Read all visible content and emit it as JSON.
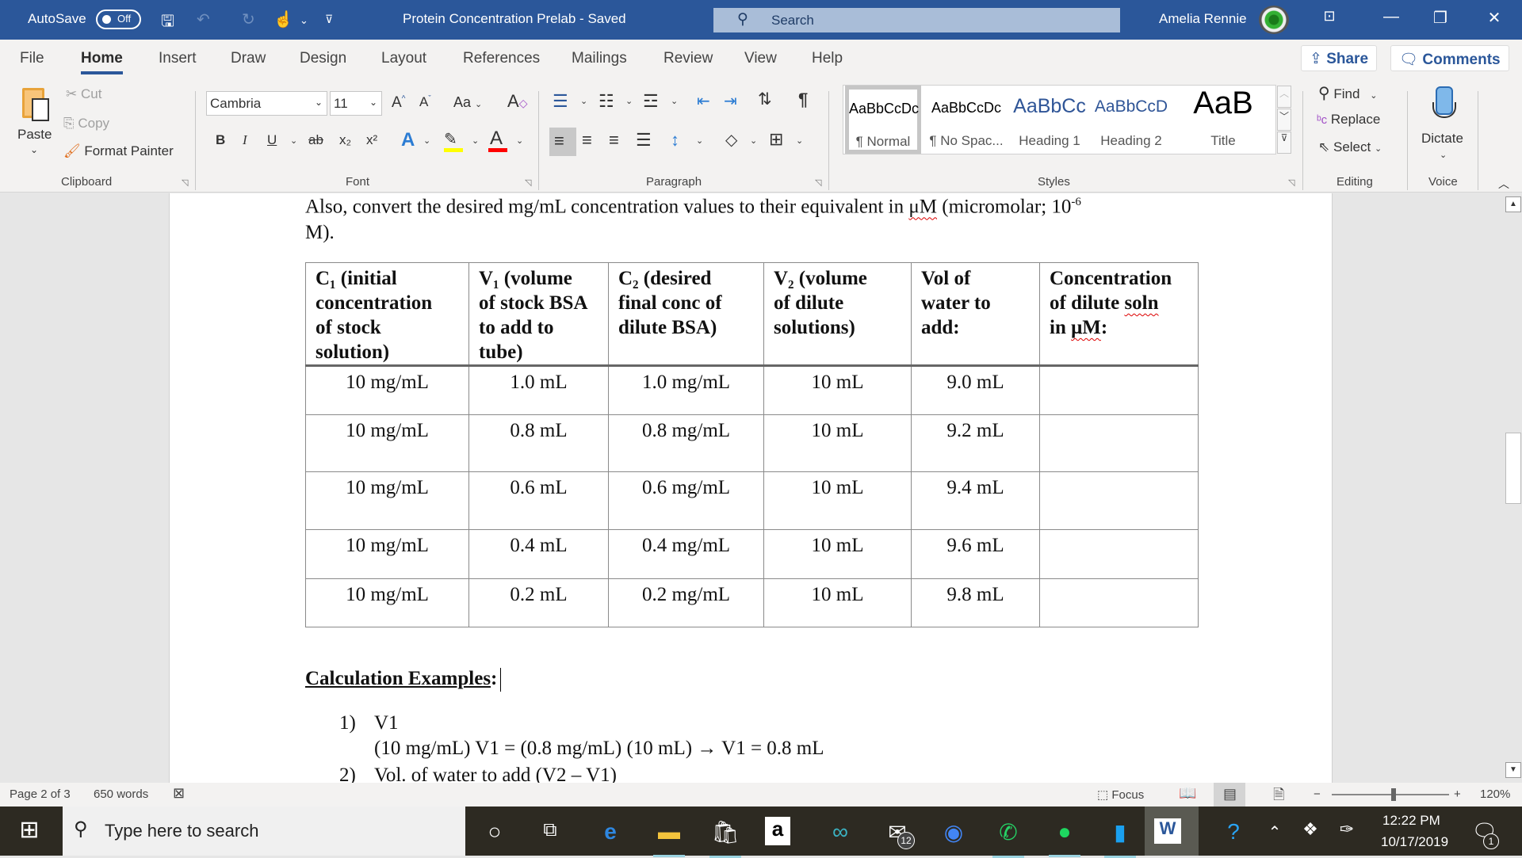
{
  "titlebar": {
    "autosave_label": "AutoSave",
    "autosave_state": "Off",
    "doc_title": "Protein Concentration Prelab",
    "separator": "-",
    "save_status": "Saved",
    "search_placeholder": "Search",
    "user_name": "Amelia Rennie"
  },
  "tabs": [
    "File",
    "Home",
    "Insert",
    "Draw",
    "Design",
    "Layout",
    "References",
    "Mailings",
    "Review",
    "View",
    "Help"
  ],
  "active_tab": "Home",
  "top_buttons": {
    "share": "Share",
    "comments": "Comments"
  },
  "ribbon": {
    "clipboard": {
      "paste": "Paste",
      "cut": "Cut",
      "copy": "Copy",
      "format_painter": "Format Painter",
      "label": "Clipboard"
    },
    "font": {
      "name": "Cambria",
      "size": "11",
      "label": "Font",
      "change_case": "Aa",
      "bold": "B",
      "italic": "I",
      "underline": "U",
      "strikethrough": "ab",
      "subscript": "x₂",
      "superscript": "x²",
      "highlight_color": "#ffff00",
      "font_color": "#ff0000"
    },
    "paragraph": {
      "label": "Paragraph",
      "pilcrow": "¶"
    },
    "styles": {
      "label": "Styles",
      "items": [
        {
          "preview": "AaBbCcDc",
          "name": "¶ Normal",
          "selected": true
        },
        {
          "preview": "AaBbCcDc",
          "name": "¶ No Spac...",
          "selected": false
        },
        {
          "preview": "AaBbCc",
          "name": "Heading 1",
          "selected": false
        },
        {
          "preview": "AaBbCcD",
          "name": "Heading 2",
          "selected": false
        },
        {
          "preview": "AaB",
          "name": "Title",
          "selected": false
        }
      ]
    },
    "editing": {
      "label": "Editing",
      "find": "Find",
      "replace": "Replace",
      "select": "Select"
    },
    "voice": {
      "label": "Voice",
      "dictate": "Dictate"
    }
  },
  "document": {
    "intro_line1": "Also, convert the desired mg/mL concentration values to their equivalent in μM (micromolar; 10",
    "intro_sup": "-6",
    "intro_line2": "M).",
    "table": {
      "headers": [
        [
          "C₁ (initial",
          "concentration",
          "of stock",
          "solution)"
        ],
        [
          "V₁  (volume",
          "of stock BSA",
          "to add to",
          "tube)"
        ],
        [
          "C₂  (desired",
          "final conc  of",
          "dilute BSA)"
        ],
        [
          "V₂  (volume",
          "of dilute",
          "solutions)"
        ],
        [
          "Vol of",
          "water to",
          "add:"
        ],
        [
          "Concentration",
          "of dilute soln",
          "in μM:"
        ]
      ],
      "rows": [
        [
          "10 mg/mL",
          "1.0 mL",
          "1.0 mg/mL",
          "10 mL",
          "9.0 mL",
          ""
        ],
        [
          "10 mg/mL",
          "0.8 mL",
          "0.8 mg/mL",
          "10 mL",
          "9.2 mL",
          ""
        ],
        [
          "10 mg/mL",
          "0.6 mL",
          "0.6 mg/mL",
          "10 mL",
          "9.4 mL",
          ""
        ],
        [
          "10 mg/mL",
          "0.4 mL",
          "0.4 mg/mL",
          "10 mL",
          "9.6 mL",
          ""
        ],
        [
          "10 mg/mL",
          "0.2 mL",
          "0.2 mg/mL",
          "10 mL",
          "9.8 mL",
          ""
        ]
      ]
    },
    "calc_heading": "Calculation Examples",
    "calc_colon": ":",
    "calc_items": [
      {
        "num": "1)",
        "title": "V1",
        "line": "(10 mg/mL) V1 = (0.8 mg/mL) (10 mL) → V1 = 0.8 mL"
      },
      {
        "num": "2)",
        "title": "Vol. of water to add (V2 – V1)"
      }
    ]
  },
  "statusbar": {
    "page": "Page 2 of 3",
    "words": "650 words",
    "focus": "Focus",
    "zoom_minus": "−",
    "zoom_plus": "+",
    "zoom_level": "120%"
  },
  "taskbar": {
    "search_placeholder": "Type here to search",
    "mail_badge": "12",
    "time": "12:22 PM",
    "date": "10/17/2019",
    "notification_count": "1"
  }
}
